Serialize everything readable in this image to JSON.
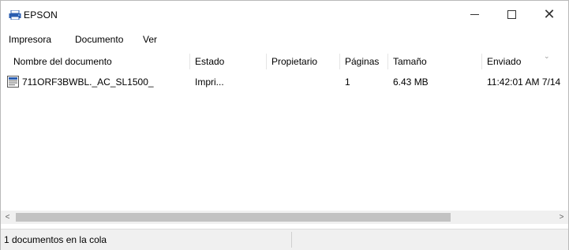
{
  "window": {
    "title": "EPSON",
    "controls": {
      "minimize": "—",
      "maximize": "☐",
      "close": "✕"
    }
  },
  "menu": [
    "Impresora",
    "Documento",
    "Ver"
  ],
  "columns": [
    "Nombre del documento",
    "Estado",
    "Propietario",
    "Páginas",
    "Tamaño",
    "Enviado"
  ],
  "rows": [
    {
      "name": "711ORF3BWBL._AC_SL1500_",
      "status": "Impri...",
      "owner": "",
      "pages": "1",
      "size": "6.43 MB",
      "sent": "11:42:01 AM  7/14"
    }
  ],
  "scrollbar": {
    "left_arrow": "<",
    "right_arrow": ">"
  },
  "status_bar": {
    "text": "1 documentos en la cola"
  },
  "colors": {
    "icon_blue": "#2a5db0",
    "scroll_thumb": "#c2c2c2",
    "chrome_bg": "#f0f0f0"
  },
  "icons": {
    "app": "printer-icon",
    "document": "document-icon"
  }
}
